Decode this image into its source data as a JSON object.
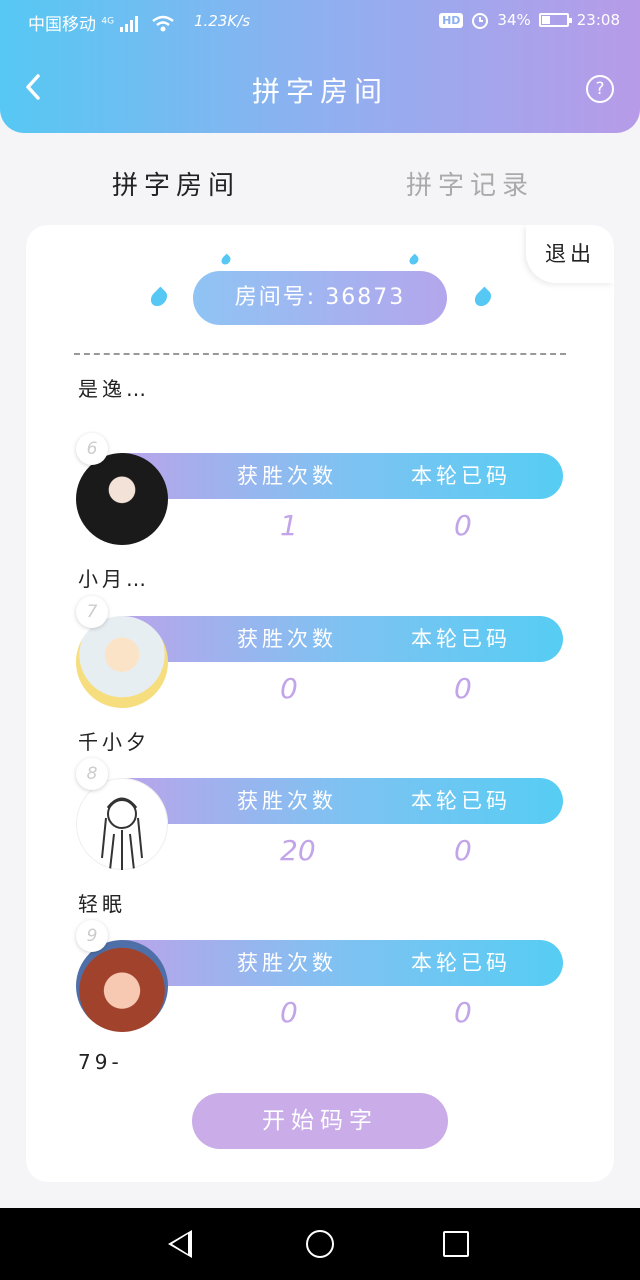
{
  "status_bar": {
    "carrier": "中国移动",
    "network": "4G",
    "speed": "1.23K/s",
    "hd": "HD",
    "battery": "34%",
    "battery_level": 0.34,
    "time": "23:08"
  },
  "header": {
    "title": "拼字房间",
    "back_icon": "chevron-left-icon",
    "help_icon": "question-circle-icon",
    "help_glyph": "?"
  },
  "tabs": [
    {
      "label": "拼字房间",
      "active": true
    },
    {
      "label": "拼字记录",
      "active": false
    }
  ],
  "room": {
    "label": "房间号: 36873",
    "exit_label": "退出",
    "wins_label": "获胜次数",
    "typed_label": "本轮已码"
  },
  "players": [
    {
      "rank": "",
      "name": "是逸…",
      "wins": "0",
      "typed": "0"
    },
    {
      "rank": "6",
      "name": "小月…",
      "wins": "1",
      "typed": "0"
    },
    {
      "rank": "7",
      "name": "千小夕",
      "wins": "0",
      "typed": "0"
    },
    {
      "rank": "8",
      "name": "轻眠",
      "wins": "20",
      "typed": "0"
    },
    {
      "rank": "9",
      "name": "79-",
      "wins": "0",
      "typed": "0"
    }
  ],
  "actions": {
    "start_label": "开始码字"
  },
  "colors": {
    "header_start": "#56c8f3",
    "header_end": "#b79be8",
    "value_purple": "#c2a4e8",
    "start_button": "#c9ace8"
  }
}
